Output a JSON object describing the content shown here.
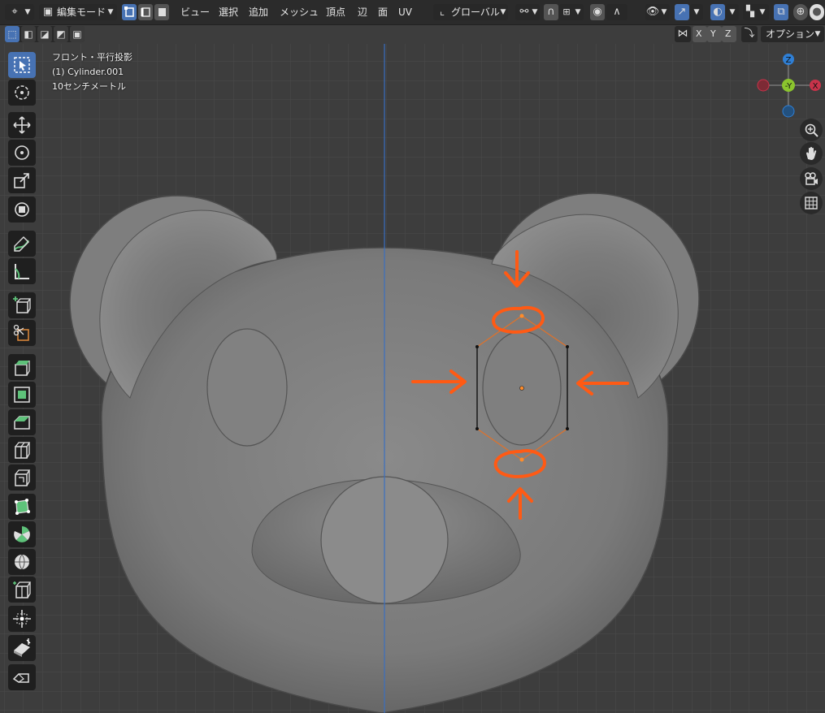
{
  "header": {
    "mode_label": "編集モード",
    "menu": [
      "ビュー",
      "選択",
      "追加",
      "メッシュ",
      "頂点",
      "辺",
      "面",
      "UV"
    ],
    "orientation_label": "グローバル"
  },
  "subheader": {
    "axis_x": "X",
    "axis_y": "Y",
    "axis_z": "Z",
    "options_label": "オプション"
  },
  "viewport": {
    "view_name": "フロント・平行投影",
    "object_name": "(1) Cylinder.001",
    "scale_label": "10センチメートル"
  },
  "gizmo": {
    "x": "X",
    "y": "-Y",
    "z": "Z"
  },
  "colors": {
    "accent": "#4772b3",
    "annotation": "#ff5a14",
    "axis_x": "#c8334a",
    "axis_y": "#8bc42e",
    "axis_z": "#2f7fd5",
    "viewport_bg": "#3d3d3d"
  },
  "icons": {
    "toolbar": [
      "select-box-icon",
      "cursor-icon",
      "move-icon",
      "rotate-icon",
      "scale-icon",
      "transform-icon",
      "annotate-icon",
      "measure-icon",
      "add-cube-icon",
      "knife-cube-icon",
      "extrude-icon",
      "inset-icon",
      "bevel-icon",
      "loop-cut-icon",
      "offset-cut-icon",
      "poly-build-icon",
      "spin-icon",
      "smooth-icon",
      "edge-slide-icon",
      "shrink-fatten-icon",
      "shear-icon",
      "rip-region-icon"
    ],
    "navigation": [
      "zoom-icon",
      "hand-pan-icon",
      "camera-icon",
      "grid-ortho-icon"
    ]
  }
}
